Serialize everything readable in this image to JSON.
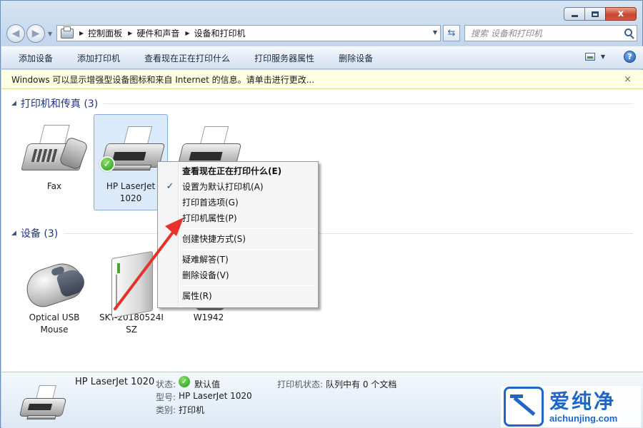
{
  "window": {
    "caption_min": "",
    "caption_max": "",
    "caption_close": "x"
  },
  "address": {
    "crumbs": [
      "控制面板",
      "硬件和声音",
      "设备和打印机"
    ]
  },
  "search": {
    "placeholder": "搜索 设备和打印机"
  },
  "commands": [
    "添加设备",
    "添加打印机",
    "查看现在正在打印什么",
    "打印服务器属性",
    "删除设备"
  ],
  "infobar": {
    "text": "Windows 可以显示增强型设备图标和来自 Internet 的信息。请单击进行更改...",
    "close": "×"
  },
  "groups": {
    "printers_title": "打印机和传真 (3)",
    "devices_title": "设备 (3)"
  },
  "printers": [
    {
      "label": "Fax"
    },
    {
      "label": "HP LaserJet 1020"
    },
    {
      "label": ""
    }
  ],
  "devices": [
    {
      "label": "Optical USB Mouse"
    },
    {
      "label": "SKY-20180524I SZ"
    },
    {
      "label": "W1942"
    }
  ],
  "context_menu": {
    "items": [
      {
        "label": "查看现在正在打印什么(E)"
      },
      {
        "label": "设置为默认打印机(A)",
        "check": "✓"
      },
      {
        "label": "打印首选项(G)"
      },
      {
        "label": "打印机属性(P)"
      },
      {
        "label": "创建快捷方式(S)"
      },
      {
        "label": "疑难解答(T)"
      },
      {
        "label": "删除设备(V)"
      },
      {
        "label": "属性(R)"
      }
    ]
  },
  "details": {
    "name": "HP LaserJet 1020",
    "status_label": "状态:",
    "status_value": "默认值",
    "model_label": "型号:",
    "model_value": "HP LaserJet 1020",
    "category_label": "类别:",
    "category_value": "打印机",
    "printer_status_label": "打印机状态:",
    "printer_status_value": "队列中有 0 个文档"
  },
  "watermark": {
    "big": "爱纯净",
    "url": "aichunjing.com"
  },
  "colors": {
    "arrow": "#e8312a",
    "link_blue": "#1e3287",
    "watermark_blue": "#1f66c6"
  }
}
